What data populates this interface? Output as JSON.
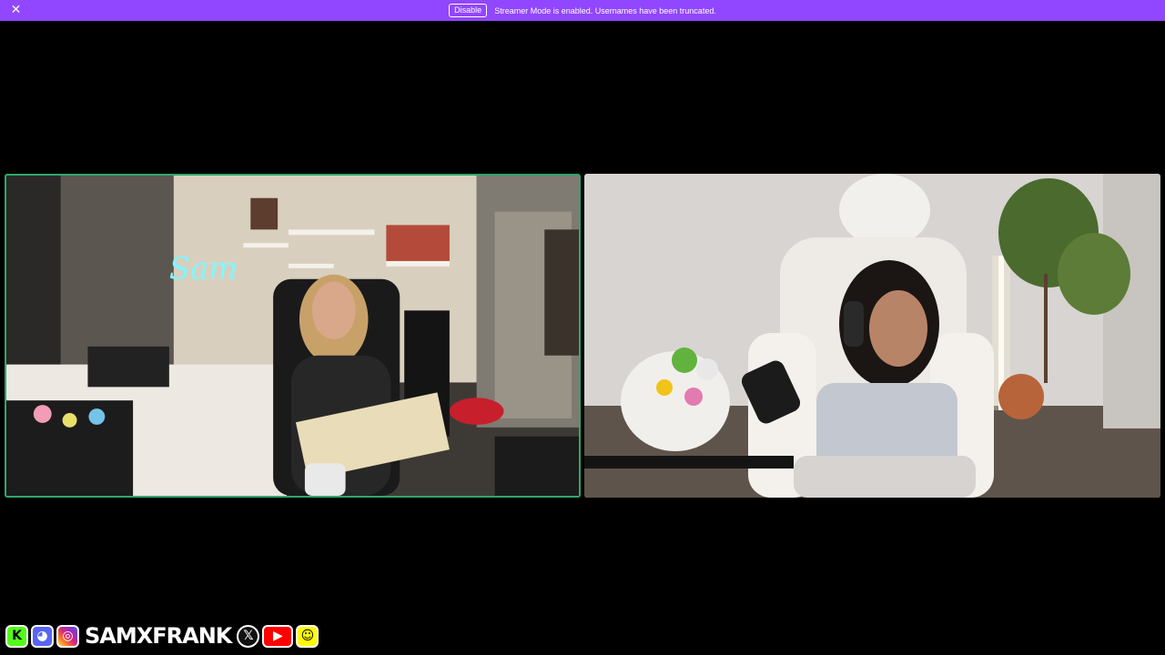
{
  "banner": {
    "message": "Streamer Mode is enabled. Usernames have been truncated.",
    "disable_label": "Disable",
    "close_glyph": "✕",
    "color": "#9146ff"
  },
  "streams": {
    "left_tile": {
      "active_speaker": true,
      "border_color": "#2ea86b"
    },
    "right_tile": {
      "active_speaker": false
    }
  },
  "overlay": {
    "handle": "SAMXFRANK",
    "icons": [
      {
        "name": "kick-icon",
        "glyph": "K"
      },
      {
        "name": "discord-icon",
        "glyph": "◕"
      },
      {
        "name": "instagram-icon",
        "glyph": "◎"
      },
      {
        "name": "x-icon",
        "glyph": "𝕏"
      },
      {
        "name": "youtube-icon",
        "glyph": "▶"
      },
      {
        "name": "snapchat-icon",
        "glyph": "☺"
      }
    ]
  }
}
